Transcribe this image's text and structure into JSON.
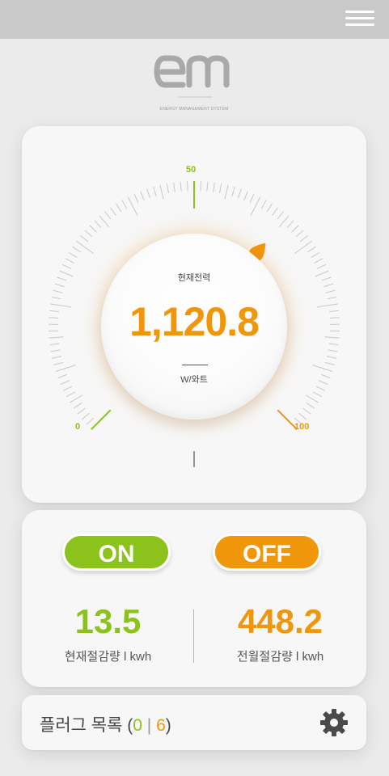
{
  "header": {
    "menu_icon": "hamburger-menu-icon"
  },
  "logo": {
    "text": "EM",
    "subtitle": "ENERGY MANAGEMENT SYSTEM"
  },
  "gauge": {
    "label": "현재전력",
    "value": "1,120.8",
    "unit": "W/와트",
    "min_label": "0",
    "mid_label": "50",
    "max_label": "100",
    "level_percent": 65,
    "colors": {
      "green": "#8cc21c",
      "orange": "#f0960a"
    }
  },
  "controls": {
    "on_label": "ON",
    "off_label": "OFF"
  },
  "stats": {
    "current": {
      "value": "13.5",
      "label": "현재절감량 l kwh"
    },
    "last_month": {
      "value": "448.2",
      "label": "전월절감량 l kwh"
    }
  },
  "plug_list": {
    "title": "플러그 목록 (",
    "active_count": "0",
    "separator": " | ",
    "total_count": "6",
    "close": ")",
    "settings_icon": "gear-icon"
  }
}
